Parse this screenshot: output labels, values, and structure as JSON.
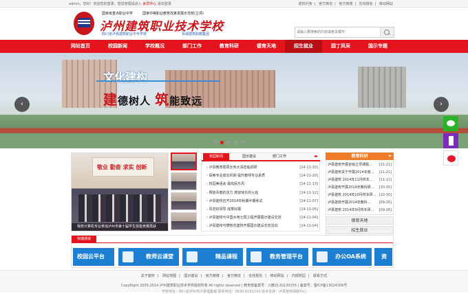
{
  "topbar": {
    "user": "admin",
    "greeting": "，您好！欢迎您的登录，借息管理请进入",
    "member_center": "会员中心",
    "logout": "退出登录",
    "links": [
      "建校问答",
      "官方微信",
      "官方微博",
      "在线报名",
      "移动网站"
    ]
  },
  "header": {
    "tagline1": "国家级重点职业中学",
    "tagline2": "国家中等职业教育改革发展示范校(立项)",
    "school_name": "泸州建筑职业技术学校",
    "sub_left": "四川省泸县建筑职业中专学校",
    "sub_right": "百城建筑职教集团",
    "search_placeholder": "请输入要搜索的内容或者关键字"
  },
  "nav": {
    "items": [
      "网站首页",
      "校园新闻",
      "学校概况",
      "部门工作",
      "教育科研",
      "德育天地",
      "招生就业",
      "园丁风采",
      "国示专题"
    ],
    "active_index": 6
  },
  "banner": {
    "title": "文化建构",
    "slogan_a": "建",
    "slogan_b": "德树人",
    "slogan_c": "筑",
    "slogan_d": "能致远",
    "prev": "‹",
    "next": "›",
    "slide_count": 5,
    "active_slide": 1
  },
  "photo_news": {
    "board": "敬业 勤奋 求实 创新",
    "caption": "我校计算机专业参加泸州市第十届学生技能竞赛再获"
  },
  "news": {
    "tabs": [
      "校园新闻",
      "国示建设",
      "部门工作"
    ],
    "arrow": "◂▸",
    "items": [
      {
        "title": "泸县教育局局长朱大清莅临调研",
        "date": "[14-11-20]"
      },
      {
        "title": "探索专业成长机制 提升教师专业素质",
        "date": "[14-11-20]"
      },
      {
        "title": "校园美语会 最炫民乐风",
        "date": "[14-11-13]"
      },
      {
        "title": "释放青春的活力 燃烧快乐的火焰",
        "date": "[14-11-12]"
      },
      {
        "title": "泸县建校召开2014年秋期半期考试",
        "date": "[14-11-07]"
      },
      {
        "title": "风范好领导 成果好展",
        "date": "[14-11-05]"
      },
      {
        "title": "泸县建校与中国水电七局工程开展展示建设交流",
        "date": "[14-11-04]"
      },
      {
        "title": "泸县建校与攀枝花建校开展国示建设交流活动",
        "date": "[14-11-04]"
      }
    ]
  },
  "edu": {
    "title": "教育科研",
    "arrow": "◂▸",
    "items": [
      {
        "title": "泸县建校开展省级立项课题...",
        "date": "[11-21]"
      },
      {
        "title": "泸县建校关于开展2014年度...",
        "date": "[11-21]"
      },
      {
        "title": "泸县建校 2014年11月校本...",
        "date": "[11-12]"
      },
      {
        "title": "泸县建校开展2014年教科研...",
        "date": "[10-30]"
      },
      {
        "title": "泸县建校 2014年10月校本研...",
        "date": "[10-30]"
      },
      {
        "title": "泸县建校开展2014年教科...",
        "date": "[09-26]"
      },
      {
        "title": "泸县建校 2014年9月校本研...",
        "date": "[09-26]"
      }
    ],
    "sub1": "德育天地",
    "sub2": "招生就业"
  },
  "quick": {
    "title": "快捷通道",
    "buttons": [
      "校园云平台",
      "教师云课堂",
      "精品课程",
      "教务管理平台",
      "办公OA系统",
      "资"
    ]
  },
  "footer": {
    "links": [
      "关于建校",
      "网站地图",
      "国示建设",
      "官方微博",
      "官方微信",
      "在线报名",
      "移动网站",
      "内部校园",
      "联系方式"
    ],
    "copyright": "CopyRight 2005-2014 泸州建筑职业技术学校版权所有 All rights reserved | 教育部备案号：川教ZJ-20130155 | 备案号：蜀ICP备13024306号",
    "address": "学校地址：四川省泸州市泸县福集镇  联系电话：0830-8181234  技术支持：泸县建校网络中心"
  },
  "colors": {
    "brand_red": "#e3141b",
    "accent_orange": "#f07b2a",
    "quick_blue": "#1d7fd1"
  }
}
